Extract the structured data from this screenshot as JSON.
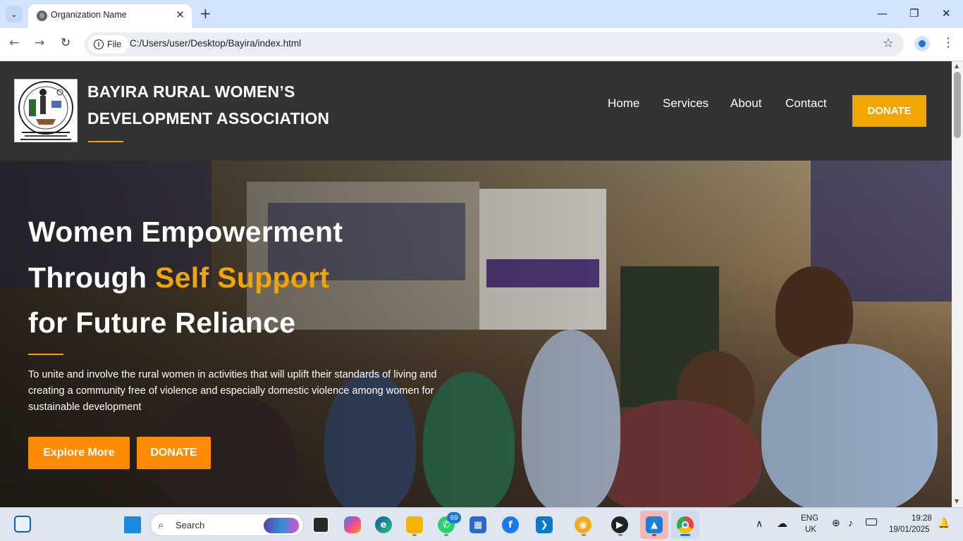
{
  "browser": {
    "tab_title": "Organization Name",
    "new_tab": "+",
    "chip_label": "File",
    "url": "C:/Users/user/Desktop/Bayira/index.html"
  },
  "site": {
    "brand_line1": "BAYIRA RURAL WOMEN’S",
    "brand_line2": "DEVELOPMENT ASSOCIATION",
    "nav": [
      "Home",
      "Services",
      "About",
      "Contact"
    ],
    "donate_top": "DONATE",
    "hero": {
      "line1": "Women Empowerment",
      "line2_plain": "Through ",
      "line2_accent": "Self Support",
      "line3": "for Future Reliance",
      "text": "To unite and involve the rural women in activities that will uplift their standards of living and creating a community free of violence and especially domestic violence among women for sustainable development",
      "btn_explore": "Explore More",
      "btn_donate": "DONATE"
    },
    "colors": {
      "accent": "#f0a500",
      "button": "#ff8c00",
      "header": "#333333"
    }
  },
  "taskbar": {
    "search_label": "Search",
    "whatsapp_badge": "69",
    "lang": "ENG",
    "region": "UK",
    "time": "19:28",
    "date": "19/01/2025"
  }
}
